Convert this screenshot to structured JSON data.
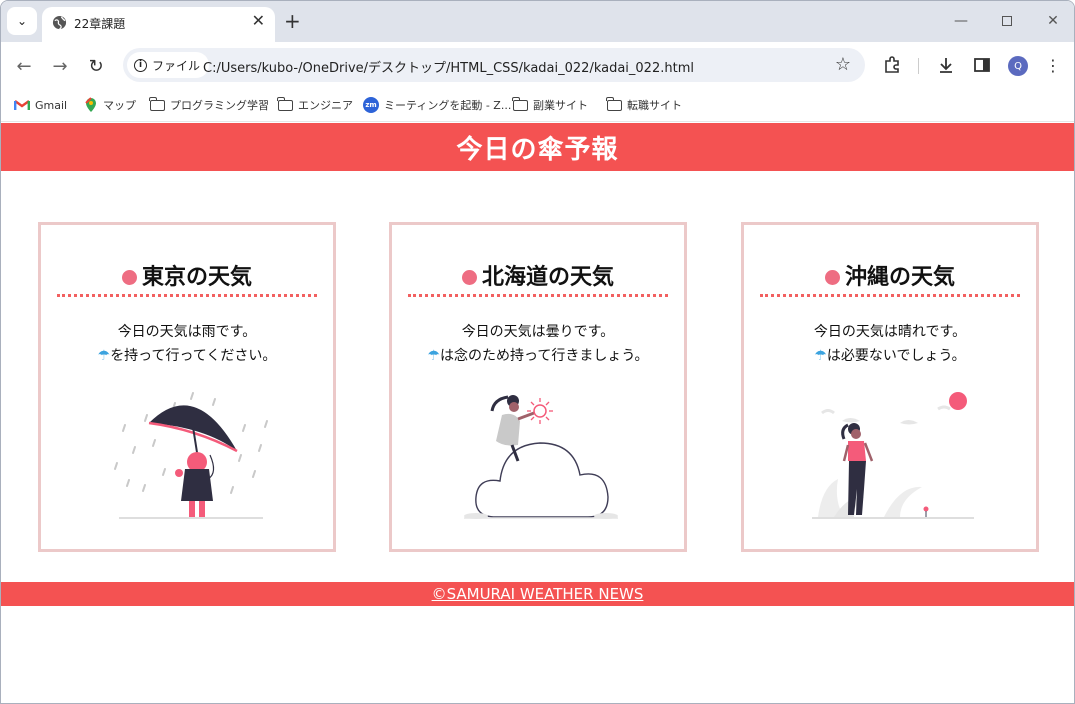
{
  "browser": {
    "tab_title": "22章課題",
    "url_chip": "ファイル",
    "url": "C:/Users/kubo-/OneDrive/デスクトップ/HTML_CSS/kadai_022/kadai_022.html",
    "profile_initial": "Q",
    "bookmarks": [
      "Gmail",
      "マップ",
      "プログラミング学習",
      "エンジニア",
      "ミーティングを起動 - Z...",
      "副業サイト",
      "転職サイト"
    ]
  },
  "page": {
    "header_title": "今日の傘予報",
    "umbrella_icon": "☂",
    "cards": [
      {
        "title": "東京の天気",
        "line1": "今日の天気は雨です。",
        "line2": "を持って行ってください。",
        "illustration": "rain-umbrella"
      },
      {
        "title": "北海道の天気",
        "line1": "今日の天気は曇りです。",
        "line2": "は念のため持って行きましょう。",
        "illustration": "cloud"
      },
      {
        "title": "沖縄の天気",
        "line1": "今日の天気は晴れです。",
        "line2": "は必要ないでしょう。",
        "illustration": "sunny"
      }
    ],
    "footer_text": "©SAMURAI WEATHER NEWS"
  },
  "colors": {
    "brand_red": "#f45252",
    "card_border": "#ecc9c9",
    "dot_pink": "#ee6d82",
    "umbrella_blue": "#3ba3df"
  }
}
